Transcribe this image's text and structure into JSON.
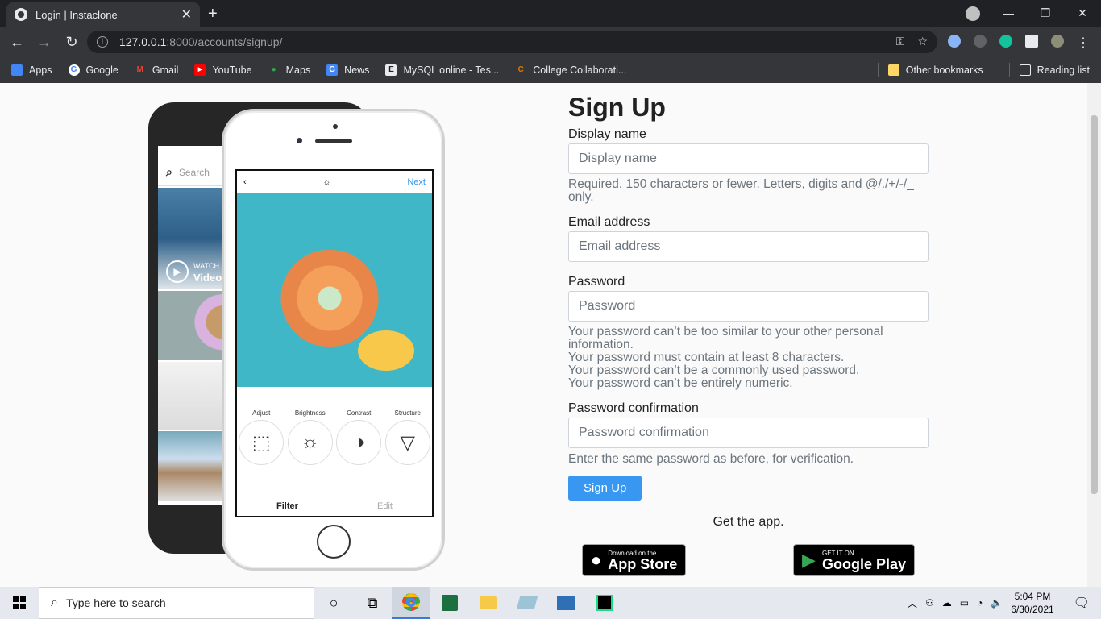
{
  "browser": {
    "tab_title": "Login | Instaclone",
    "close_tab": "✕",
    "new_tab": "+",
    "url_host": "127.0.0.1",
    "url_path": ":8000/accounts/signup/",
    "window_controls": {
      "minimize": "—",
      "restore": "❐",
      "close": "✕"
    }
  },
  "bookmarks": {
    "items": [
      {
        "label": "Apps",
        "icon": "apps-grid-icon",
        "color": "#f28b82"
      },
      {
        "label": "Google",
        "icon": "google-icon",
        "color": "#4285f4"
      },
      {
        "label": "Gmail",
        "icon": "gmail-icon",
        "color": "#ea4335"
      },
      {
        "label": "YouTube",
        "icon": "youtube-icon",
        "color": "#ff0000"
      },
      {
        "label": "Maps",
        "icon": "maps-pin-icon",
        "color": "#34a853"
      },
      {
        "label": "News",
        "icon": "news-icon",
        "color": "#4285f4"
      },
      {
        "label": "MySQL online - Tes...",
        "icon": "e-letter-icon",
        "color": "#9aa0a6"
      },
      {
        "label": "College Collaborati...",
        "icon": "c-logo-icon",
        "color": "#e37400"
      }
    ],
    "other": "Other bookmarks",
    "reading_list": "Reading list"
  },
  "promo": {
    "search_placeholder": "Search",
    "watch": "WATCH",
    "video": "Video",
    "next": "Next",
    "tools": [
      "Adjust",
      "Brightness",
      "Contrast",
      "Structure"
    ],
    "tab_filter": "Filter",
    "tab_edit": "Edit"
  },
  "form": {
    "title": "Sign Up",
    "display_name": {
      "label": "Display name",
      "placeholder": "Display name",
      "help": "Required. 150 characters or fewer. Letters, digits and @/./+/-/_ only."
    },
    "email": {
      "label": "Email address",
      "placeholder": "Email address"
    },
    "password": {
      "label": "Password",
      "placeholder": "Password",
      "help": [
        "Your password can’t be too similar to your other personal information.",
        "Your password must contain at least 8 characters.",
        "Your password can’t be a commonly used password.",
        "Your password can’t be entirely numeric."
      ]
    },
    "password_confirm": {
      "label": "Password confirmation",
      "placeholder": "Password confirmation",
      "help": "Enter the same password as before, for verification."
    },
    "submit": "Sign Up",
    "get_app": "Get the app.",
    "appstore_small": "Download on the",
    "appstore_big": "App Store",
    "googleplay_small": "GET IT ON",
    "googleplay_big": "Google Play"
  },
  "taskbar": {
    "search_placeholder": "Type here to search",
    "time": "5:04 PM",
    "date": "6/30/2021"
  }
}
